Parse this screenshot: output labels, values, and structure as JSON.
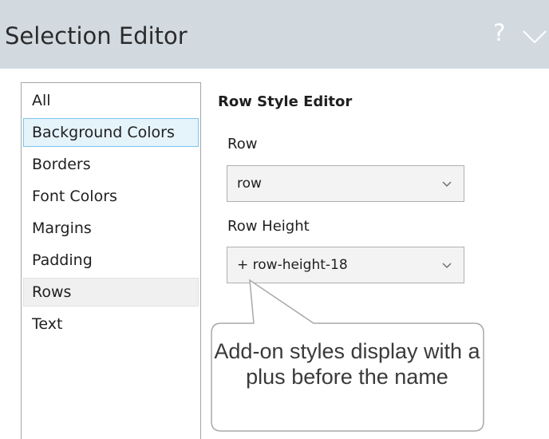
{
  "window": {
    "title": "Selection Editor",
    "help_glyph": "?",
    "collapse_icon": "chevron-down-icon"
  },
  "category_list": {
    "items": [
      {
        "label": "All"
      },
      {
        "label": "Background Colors",
        "state": "selected"
      },
      {
        "label": "Borders"
      },
      {
        "label": "Font Colors"
      },
      {
        "label": "Margins"
      },
      {
        "label": "Padding"
      },
      {
        "label": "Rows",
        "state": "hover"
      },
      {
        "label": "Text"
      }
    ]
  },
  "editor": {
    "title": "Row Style Editor",
    "row": {
      "label": "Row",
      "value": "row"
    },
    "row_height": {
      "label": "Row Height",
      "value": "+ row-height-18"
    }
  },
  "callout": {
    "text": "Add-on styles display with a plus before the name"
  },
  "colors": {
    "titlebar": "#d2dae0",
    "selected_item": "#e5f3fb",
    "selected_border": "#7fc4ec"
  }
}
